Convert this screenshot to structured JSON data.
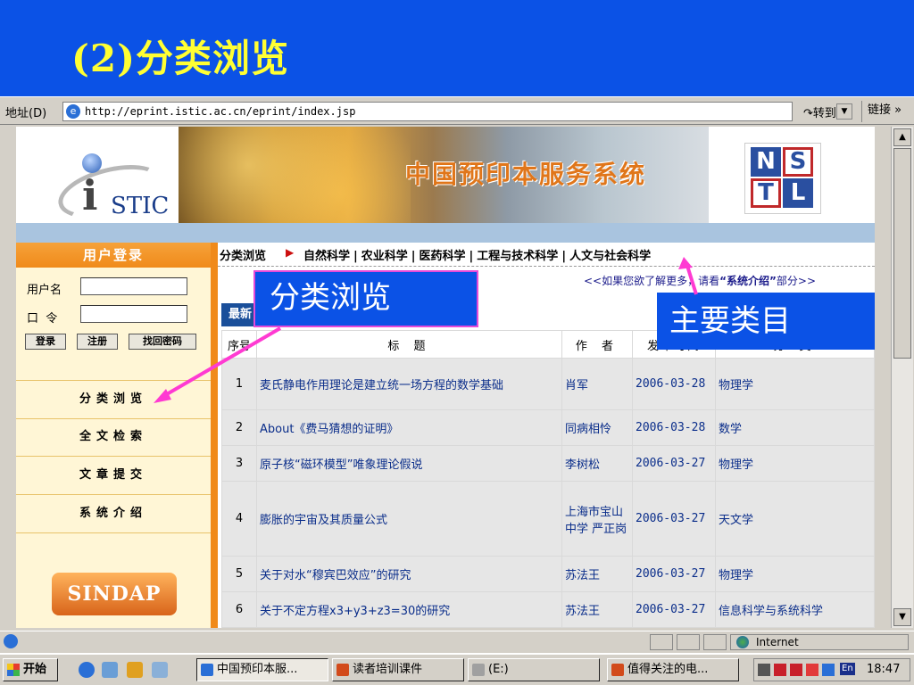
{
  "slide": {
    "title": "(2)分类浏览"
  },
  "addressbar": {
    "label": "地址(D)",
    "url": "http://eprint.istic.ac.cn/eprint/index.jsp",
    "go_label": "转到",
    "links_label": "链接 »"
  },
  "banner": {
    "istic_logo_text": "STIC",
    "site_title": "中国预印本服务系统",
    "nstl_letters": [
      "N",
      "S",
      "T",
      "L"
    ]
  },
  "login": {
    "header": "用户登录",
    "username_label": "用户名",
    "password_label": "口  令",
    "username_value": "",
    "password_value": "",
    "login_button": "登录",
    "register_button": "注册",
    "recover_button": "找回密码"
  },
  "left_menu": {
    "items": [
      {
        "label": "分类浏览"
      },
      {
        "label": "全文检索"
      },
      {
        "label": "文章提交"
      },
      {
        "label": "系统介绍"
      }
    ],
    "sindap_logo": "SINDAP"
  },
  "category_bar": {
    "label": "分类浏览",
    "categories": [
      "自然科学",
      "农业科学",
      "医药科学",
      "工程与技术科学",
      "人文与社会科学"
    ]
  },
  "hint": {
    "text_before": "<<如果您欲了解更多，请看",
    "link": "“系统介绍”",
    "text_after": "部分>>"
  },
  "latest_tab": "最新",
  "table": {
    "headers": [
      "序号",
      "标 题",
      "作 者",
      "发布时间",
      "分 类"
    ],
    "rows": [
      {
        "no": "1",
        "title": "麦氏静电作用理论是建立统一场方程的数学基础",
        "author": "肖军",
        "date": "2006-03-28",
        "category": "物理学"
      },
      {
        "no": "2",
        "title": "About《费马猜想的证明》",
        "author": "同病相怜",
        "date": "2006-03-28",
        "category": "数学"
      },
      {
        "no": "3",
        "title": "原子核“磁环模型”唯象理论假说",
        "author": "李树松",
        "date": "2006-03-27",
        "category": "物理学"
      },
      {
        "no": "4",
        "title": "膨胀的宇宙及其质量公式",
        "author": "上海市宝山中学 严正岗",
        "date": "2006-03-27",
        "category": "天文学"
      },
      {
        "no": "5",
        "title": "关于对水“穆宾巴效应”的研究",
        "author": "苏法王",
        "date": "2006-03-27",
        "category": "物理学"
      },
      {
        "no": "6",
        "title": "关于不定方程x3+y3+z3=30的研究",
        "author": "苏法王",
        "date": "2006-03-27",
        "category": "信息科学与系统科学"
      }
    ]
  },
  "annotations": {
    "left_callout": "分类浏览",
    "right_callout": "主要类目",
    "arrow_color": "#ff3ad2"
  },
  "statusbar": {
    "zone": "Internet"
  },
  "taskbar": {
    "start_label": "开始",
    "tasks": [
      {
        "label": "中国预印本服...",
        "active": true
      },
      {
        "label": "读者培训课件",
        "active": false
      },
      {
        "label": "(E:)",
        "active": false
      },
      {
        "label": "值得关注的电...",
        "active": false
      }
    ],
    "lang": "En",
    "clock": "18:47"
  }
}
